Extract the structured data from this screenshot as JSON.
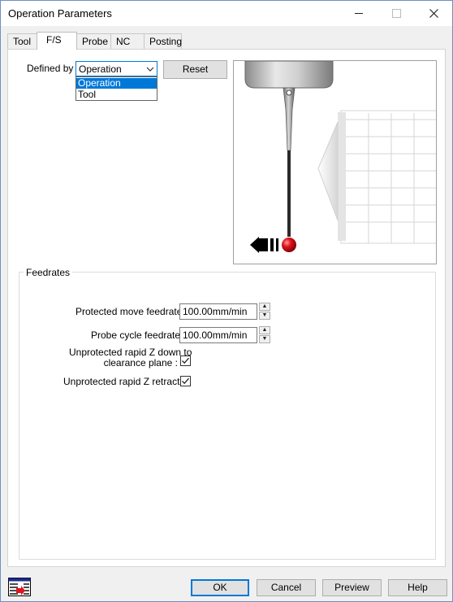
{
  "window": {
    "title": "Operation Parameters"
  },
  "titlebar": {
    "minimize": "—",
    "maximize": "☐",
    "close": "✕"
  },
  "tabs": [
    "Tool",
    "F/S",
    "Probe",
    "NC",
    "Posting"
  ],
  "active_tab": "F/S",
  "defined_by": {
    "label": "Defined by :",
    "selected": "Operation",
    "options": [
      "Operation",
      "Tool"
    ],
    "highlighted": "Operation"
  },
  "reset_button": "Reset",
  "feedrates": {
    "group_label": "Feedrates",
    "protected_move": {
      "label": "Protected move feedrate :",
      "value": "100.00mm/min"
    },
    "probe_cycle": {
      "label": "Probe cycle feedrate :",
      "value": "100.00mm/min"
    },
    "unprotected_rapid_z_down": {
      "label_line1": "Unprotected rapid Z down to",
      "label_line2": "clearance plane :",
      "checked": true
    },
    "unprotected_rapid_z_retracts": {
      "label": "Unprotected rapid Z retracts :",
      "checked": true
    }
  },
  "footer": {
    "ok": "OK",
    "cancel": "Cancel",
    "preview": "Preview",
    "help": "Help"
  },
  "colors": {
    "accent": "#0078d7",
    "probe_ball": "#e0141e"
  }
}
